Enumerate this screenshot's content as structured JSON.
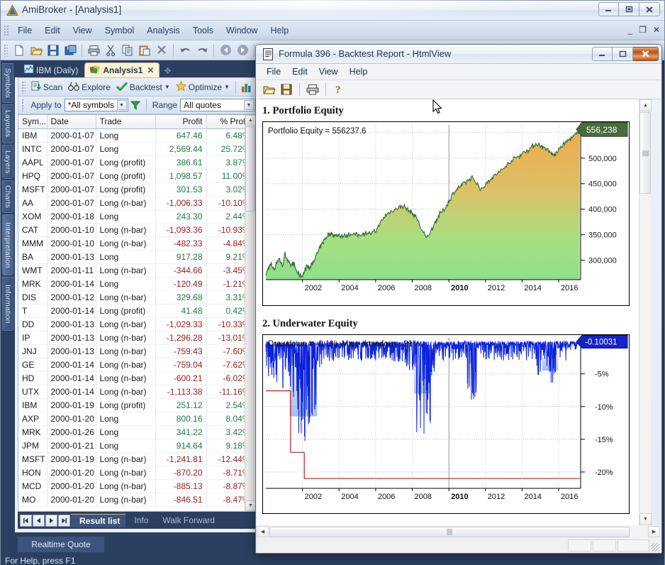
{
  "main_window": {
    "title": "AmiBroker - [Analysis1]",
    "app_icon": "amibroker-icon",
    "window_buttons": [
      {
        "name": "minimize",
        "glyph": "─"
      },
      {
        "name": "restore",
        "glyph": "▣"
      },
      {
        "name": "close",
        "glyph": "✕"
      }
    ],
    "mdi_buttons": [
      {
        "name": "mdi-minimize",
        "glyph": "_"
      },
      {
        "name": "mdi-restore",
        "glyph": "❐"
      },
      {
        "name": "mdi-close",
        "glyph": "✕"
      }
    ],
    "menu": [
      "File",
      "Edit",
      "View",
      "Symbol",
      "Analysis",
      "Tools",
      "Window",
      "Help"
    ],
    "toolbar_icons": [
      "new-document-icon",
      "open-folder-icon",
      "save-icon",
      "save-all-icon",
      "sep",
      "print-icon",
      "cut-scissors-icon",
      "copy-icon",
      "paste-icon",
      "delete-x-icon",
      "sep",
      "undo-icon",
      "redo-icon",
      "sep",
      "back-arrow-icon",
      "forward-arrow-icon",
      "sep",
      "info-icon"
    ],
    "vertical_tabs": [
      {
        "label": "Symbols",
        "active": false
      },
      {
        "label": "Layouts",
        "active": false
      },
      {
        "label": "Layers",
        "active": false
      },
      {
        "label": "Charts",
        "active": false
      },
      {
        "label": "Interpretation",
        "active": true
      },
      {
        "label": "Information",
        "active": false
      }
    ],
    "status_text": "For Help, press F1",
    "realtime_quote_label": "Realtime Quote"
  },
  "analysis": {
    "document_tabs": [
      {
        "label": "IBM (Daily)",
        "icon": "chart-thumbnail-icon",
        "active": false,
        "closable": false
      },
      {
        "label": "Analysis1",
        "icon": "analysis-icon",
        "active": true,
        "closable": true
      }
    ],
    "new_tab_glyph": "✥",
    "toolbar_buttons": [
      {
        "label": "Scan",
        "icon": "scan-icon",
        "dropdown": false
      },
      {
        "label": "Explore",
        "icon": "binoculars-icon",
        "dropdown": false
      },
      {
        "label": "Backtest",
        "icon": "green-check-icon",
        "dropdown": true
      },
      {
        "label": "Optimize",
        "icon": "star-icon",
        "dropdown": true
      }
    ],
    "toolbar_extra_icon": "bar-chart-icon",
    "apply_to_label": "Apply to",
    "apply_to_value": "*All symbols",
    "filter_icon": "funnel-filter-icon",
    "range_label": "Range",
    "range_value": "All quotes",
    "columns": [
      "Sym...",
      "Date",
      "Trade",
      "Profit",
      "% Profit"
    ],
    "rows": [
      {
        "sym": "IBM",
        "date": "2000-01-07",
        "trade": "Long",
        "profit": "647.46",
        "pct": "6.48%",
        "sign": "pos"
      },
      {
        "sym": "INTC",
        "date": "2000-01-07",
        "trade": "Long",
        "profit": "2,569.44",
        "pct": "25.72%",
        "sign": "pos"
      },
      {
        "sym": "AAPL",
        "date": "2000-01-07",
        "trade": "Long (profit)",
        "profit": "386.61",
        "pct": "3.87%",
        "sign": "pos"
      },
      {
        "sym": "HPQ",
        "date": "2000-01-07",
        "trade": "Long (profit)",
        "profit": "1,098.57",
        "pct": "11.00%",
        "sign": "pos"
      },
      {
        "sym": "MSFT",
        "date": "2000-01-07",
        "trade": "Long (profit)",
        "profit": "301.53",
        "pct": "3.02%",
        "sign": "pos"
      },
      {
        "sym": "AA",
        "date": "2000-01-07",
        "trade": "Long (n-bar)",
        "profit": "-1,006.33",
        "pct": "-10.10%",
        "sign": "neg"
      },
      {
        "sym": "XOM",
        "date": "2000-01-18",
        "trade": "Long",
        "profit": "243.30",
        "pct": "2.44%",
        "sign": "pos"
      },
      {
        "sym": "CAT",
        "date": "2000-01-10",
        "trade": "Long (n-bar)",
        "profit": "-1,093.36",
        "pct": "-10.93%",
        "sign": "neg"
      },
      {
        "sym": "MMM",
        "date": "2000-01-10",
        "trade": "Long (n-bar)",
        "profit": "-482.33",
        "pct": "-4.84%",
        "sign": "neg"
      },
      {
        "sym": "BA",
        "date": "2000-01-13",
        "trade": "Long",
        "profit": "917.28",
        "pct": "9.21%",
        "sign": "pos"
      },
      {
        "sym": "WMT",
        "date": "2000-01-11",
        "trade": "Long (n-bar)",
        "profit": "-344.66",
        "pct": "-3.45%",
        "sign": "neg"
      },
      {
        "sym": "MRK",
        "date": "2000-01-14",
        "trade": "Long",
        "profit": "-120.49",
        "pct": "-1.21%",
        "sign": "neg"
      },
      {
        "sym": "DIS",
        "date": "2000-01-12",
        "trade": "Long (n-bar)",
        "profit": "329.68",
        "pct": "3.31%",
        "sign": "pos"
      },
      {
        "sym": "T",
        "date": "2000-01-14",
        "trade": "Long (profit)",
        "profit": "41.48",
        "pct": "0.42%",
        "sign": "pos"
      },
      {
        "sym": "DD",
        "date": "2000-01-13",
        "trade": "Long (n-bar)",
        "profit": "-1,029.33",
        "pct": "-10.33%",
        "sign": "neg"
      },
      {
        "sym": "IP",
        "date": "2000-01-13",
        "trade": "Long (n-bar)",
        "profit": "-1,296.28",
        "pct": "-13.01%",
        "sign": "neg"
      },
      {
        "sym": "JNJ",
        "date": "2000-01-13",
        "trade": "Long (n-bar)",
        "profit": "-759.43",
        "pct": "-7.60%",
        "sign": "neg"
      },
      {
        "sym": "GE",
        "date": "2000-01-14",
        "trade": "Long (n-bar)",
        "profit": "-759.04",
        "pct": "-7.62%",
        "sign": "neg"
      },
      {
        "sym": "HD",
        "date": "2000-01-14",
        "trade": "Long (n-bar)",
        "profit": "-600.21",
        "pct": "-6.02%",
        "sign": "neg"
      },
      {
        "sym": "UTX",
        "date": "2000-01-14",
        "trade": "Long (n-bar)",
        "profit": "-1,113.38",
        "pct": "-11.16%",
        "sign": "neg"
      },
      {
        "sym": "IBM",
        "date": "2000-01-19",
        "trade": "Long (profit)",
        "profit": "251.12",
        "pct": "2.54%",
        "sign": "pos"
      },
      {
        "sym": "AXP",
        "date": "2000-01-20",
        "trade": "Long",
        "profit": "800.16",
        "pct": "8.04%",
        "sign": "pos"
      },
      {
        "sym": "MRK",
        "date": "2000-01-26",
        "trade": "Long",
        "profit": "341.22",
        "pct": "3.42%",
        "sign": "pos"
      },
      {
        "sym": "JPM",
        "date": "2000-01-21",
        "trade": "Long",
        "profit": "914.64",
        "pct": "9.18%",
        "sign": "pos"
      },
      {
        "sym": "MSFT",
        "date": "2000-01-19",
        "trade": "Long (n-bar)",
        "profit": "-1,241.81",
        "pct": "-12.44%",
        "sign": "neg"
      },
      {
        "sym": "HON",
        "date": "2000-01-20",
        "trade": "Long (n-bar)",
        "profit": "-870.20",
        "pct": "-8.71%",
        "sign": "neg"
      },
      {
        "sym": "MCD",
        "date": "2000-01-20",
        "trade": "Long (n-bar)",
        "profit": "-885.13",
        "pct": "-8.87%",
        "sign": "neg"
      },
      {
        "sym": "MO",
        "date": "2000-01-20",
        "trade": "Long (n-bar)",
        "profit": "-846.51",
        "pct": "-8.47%",
        "sign": "neg"
      }
    ],
    "bottom_tabs": [
      {
        "label": "Result list",
        "active": true
      },
      {
        "label": "Info",
        "active": false
      },
      {
        "label": "Walk Forward",
        "active": false
      }
    ],
    "nav_buttons": [
      "◀│",
      "◀",
      "▶",
      "│▶"
    ]
  },
  "htmlview": {
    "title": "Formula 396 - Backtest Report - HtmlView",
    "doc_icon": "document-icon",
    "window_buttons": [
      {
        "name": "minimize",
        "glyph": "─"
      },
      {
        "name": "maximize",
        "glyph": "□"
      },
      {
        "name": "close",
        "glyph": "✕"
      }
    ],
    "menu": [
      "File",
      "Edit",
      "View",
      "Help"
    ],
    "toolbar_icons": [
      "open-folder-icon",
      "save-icon",
      "print-icon",
      "help-question-icon"
    ],
    "sections": [
      {
        "heading": "1. Portfolio Equity"
      },
      {
        "heading": "2. Underwater Equity"
      }
    ],
    "scroll": {
      "up_glyph": "▲",
      "down_glyph": "▼",
      "left_glyph": "◀",
      "right_glyph": "▶"
    }
  },
  "chart_data": [
    {
      "type": "area",
      "title": "Portfolio Equity = 556237.6",
      "xlabel": "",
      "ylabel": "",
      "grid": true,
      "x_ticks": [
        "2002",
        "2004",
        "2006",
        "2008",
        "2010",
        "2012",
        "2014",
        "2016"
      ],
      "x_tick_bold": "2010",
      "y_ticks": [
        "300,000",
        "350,000",
        "400,000",
        "450,000",
        "500,000"
      ],
      "ylim": [
        262000,
        565000
      ],
      "xlim": [
        2000.0,
        2017.2
      ],
      "last_value_label": "556,238",
      "last_value": 556237.6,
      "series_name": "Portfolio Equity",
      "line_color": "#2e6b3a",
      "fill_gradient": [
        "#f0a94a",
        "#8fe08a"
      ],
      "x": [
        2000.0,
        2000.15,
        2000.3,
        2000.45,
        2000.6,
        2000.75,
        2000.9,
        2001.05,
        2001.2,
        2001.35,
        2001.5,
        2001.65,
        2001.8,
        2001.95,
        2002.1,
        2002.25,
        2002.4,
        2002.55,
        2002.7,
        2002.85,
        2003.0,
        2003.2,
        2003.4,
        2003.6,
        2003.8,
        2004.0,
        2004.25,
        2004.5,
        2004.75,
        2005.0,
        2005.25,
        2005.5,
        2005.75,
        2006.0,
        2006.25,
        2006.5,
        2006.75,
        2007.0,
        2007.25,
        2007.5,
        2007.75,
        2008.0,
        2008.25,
        2008.5,
        2008.75,
        2009.0,
        2009.25,
        2009.5,
        2009.75,
        2010.0,
        2010.25,
        2010.5,
        2010.75,
        2011.0,
        2011.25,
        2011.5,
        2011.75,
        2012.0,
        2012.25,
        2012.5,
        2012.75,
        2013.0,
        2013.25,
        2013.5,
        2013.75,
        2014.0,
        2014.25,
        2014.5,
        2014.75,
        2015.0,
        2015.25,
        2015.5,
        2015.75,
        2016.0,
        2016.25,
        2016.5,
        2016.75,
        2017.0,
        2017.15
      ],
      "y": [
        272000,
        286000,
        292000,
        281000,
        297000,
        303000,
        288000,
        312000,
        300000,
        289000,
        295000,
        281000,
        272000,
        268000,
        277000,
        290000,
        283000,
        295000,
        305000,
        316000,
        327000,
        340000,
        350000,
        352000,
        348000,
        350000,
        347000,
        350000,
        352000,
        349000,
        351000,
        355000,
        352000,
        357000,
        372000,
        386000,
        394000,
        398000,
        403000,
        407000,
        399000,
        392000,
        383000,
        360000,
        344000,
        355000,
        375000,
        390000,
        400000,
        415000,
        432000,
        441000,
        448000,
        455000,
        462000,
        452000,
        438000,
        448000,
        459000,
        466000,
        472000,
        480000,
        489000,
        497000,
        503000,
        509000,
        515000,
        521000,
        528000,
        525000,
        519000,
        512000,
        505000,
        516000,
        527000,
        534000,
        540000,
        548000,
        556238
      ]
    },
    {
      "type": "area",
      "title": "Drawdown = -0.1%, Max. drawdown -21%",
      "xlabel": "",
      "ylabel": "",
      "grid": true,
      "x_ticks": [
        "2002",
        "2004",
        "2006",
        "2008",
        "2010",
        "2012",
        "2014",
        "2016"
      ],
      "x_tick_bold": "2010",
      "y_ticks": [
        "-5%",
        "-10%",
        "-15%",
        "-20%"
      ],
      "ylim": [
        -22.5,
        0.5
      ],
      "xlim": [
        2000.0,
        2017.2
      ],
      "last_value_label": "-0.10031",
      "last_value": -0.10031,
      "current_drawdown_pct": -0.1,
      "max_drawdown_pct": -21,
      "series_name": "Underwater Equity",
      "line_color": "#0b23dd",
      "max_dd_line_color": "#c02020",
      "step_levels": [
        -7.6,
        -17.0,
        -21.0
      ]
    }
  ]
}
